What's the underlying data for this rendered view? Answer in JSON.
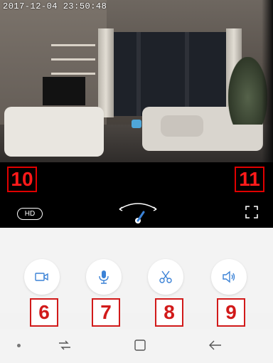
{
  "video": {
    "timestamp": "2017-12-04 23:50:48",
    "quality_badge": "HD",
    "annotations": {
      "left": "10",
      "right": "11"
    }
  },
  "actions": {
    "record": {
      "icon": "video-camera-icon",
      "label": "6"
    },
    "microphone": {
      "icon": "microphone-icon",
      "label": "7"
    },
    "snapshot": {
      "icon": "scissors-icon",
      "label": "8"
    },
    "speaker": {
      "icon": "speaker-icon",
      "label": "9"
    }
  },
  "colors": {
    "accent": "#3b82d6",
    "annotation_red": "#d11a1a",
    "strip_bg": "#000000",
    "panel_bg": "#f3f3f3"
  },
  "nav": {
    "items": [
      "recent-apps-icon",
      "home-icon",
      "back-icon"
    ]
  }
}
